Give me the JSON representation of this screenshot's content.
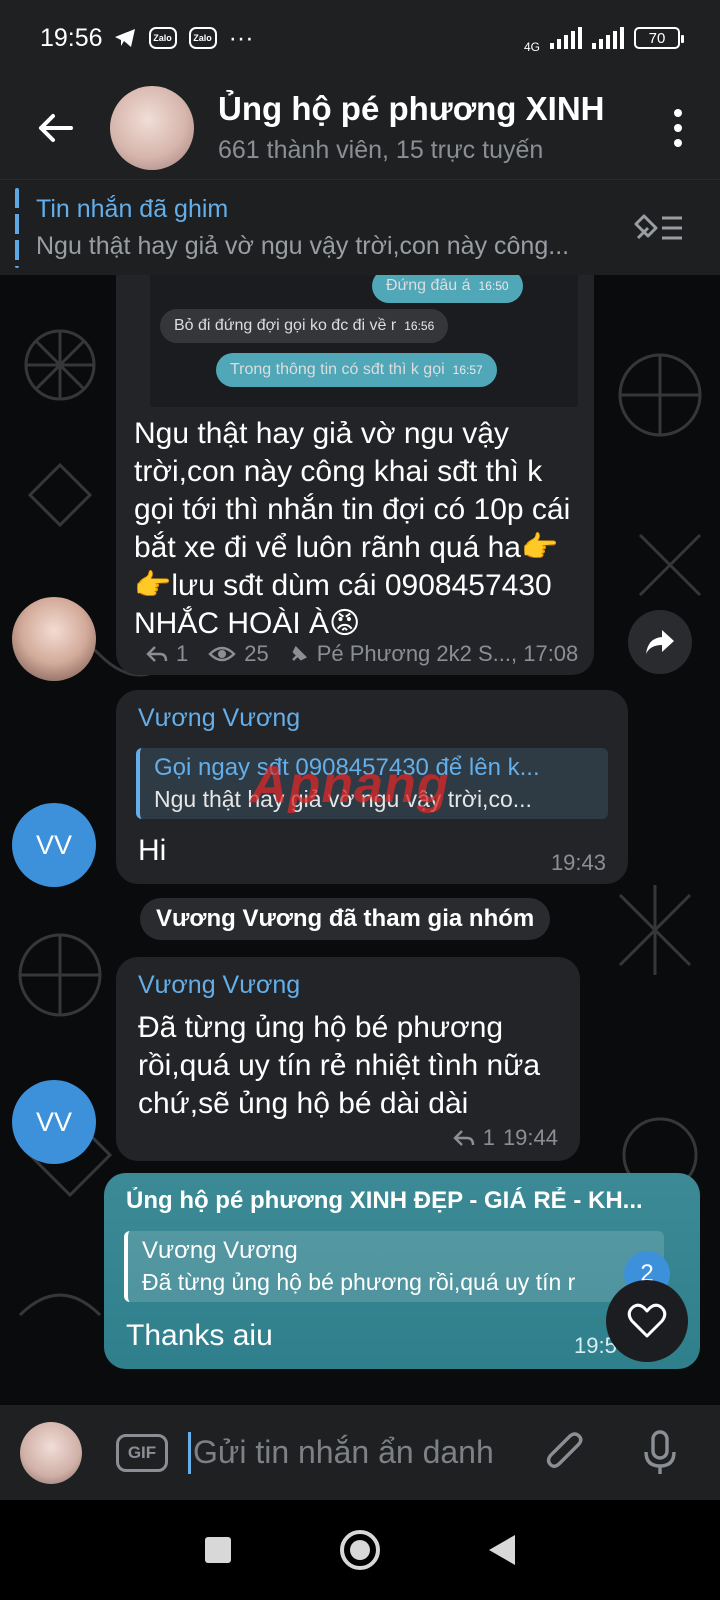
{
  "status_bar": {
    "time": "19:56",
    "zalo_1": "Zalo",
    "zalo_2": "Zalo",
    "more": "···",
    "network": "4G",
    "battery": "70"
  },
  "header": {
    "title": "Ủng hộ pé phương XINH",
    "subtitle": "661 thành viên, 15 trực tuyến"
  },
  "pinned": {
    "title": "Tin nhắn đã ghim",
    "text": "Ngu thật hay giả vờ ngu vậy trời,con này công..."
  },
  "messages": {
    "photo": {
      "msg1_text": "Đứng đâu á",
      "msg1_time": "16:50",
      "msg2_text": "Bỏ đi đứng đợi gọi ko đc đi về r",
      "msg2_time": "16:56",
      "msg3_text": "Trong thông tin có sđt thì k gọi",
      "msg3_time": "16:57"
    },
    "post": {
      "text": "Ngu thật hay giả vờ ngu vậy trời,con này công khai sđt thì k gọi tới thì nhắn tin đợi có 10p cái bắt xe đi vể luôn rãnh quá ha👉👉lưu sđt dùm cái 0908457430 NHẮC HOÀI À😡",
      "replies": "1",
      "views": "25",
      "author_time": "Pé Phương 2k2 S..., 17:08"
    },
    "vv1": {
      "avatar": "VV",
      "sender": "Vương Vương",
      "reply_title": "Gọi ngay sđt 0908457430 để lên k...",
      "reply_text": "Ngu thật hay giả vờ ngu vậy trời,co...",
      "text": "Hi",
      "time": "19:43"
    },
    "service": "Vương Vương đã tham gia nhóm",
    "vv2": {
      "avatar": "VV",
      "sender": "Vương Vương",
      "text": "Đã từng ủng hộ bé phương rồi,quá uy tín rẻ nhiệt tình nữa chứ,sẽ ủng hộ bé dài dài",
      "replies": "1",
      "time": "19:44"
    },
    "out": {
      "sender": "Ủng hộ pé phương XINH ĐẸP - GIÁ RẺ - KH...",
      "reply_title": "Vương Vương",
      "reply_text": "Đã từng ủng hộ bé phương rồi,quá uy tín r",
      "text": "Thanks aiu",
      "time": "19:5"
    },
    "reaction_count": "2",
    "watermark": "Apnang"
  },
  "input": {
    "gif_label": "GIF",
    "placeholder": "Gửi tin nhắn ẩn danh"
  },
  "colors": {
    "accent": "#64aee9",
    "out_bubble": "#3c8a96",
    "avatar_vv": "#3d91db"
  }
}
